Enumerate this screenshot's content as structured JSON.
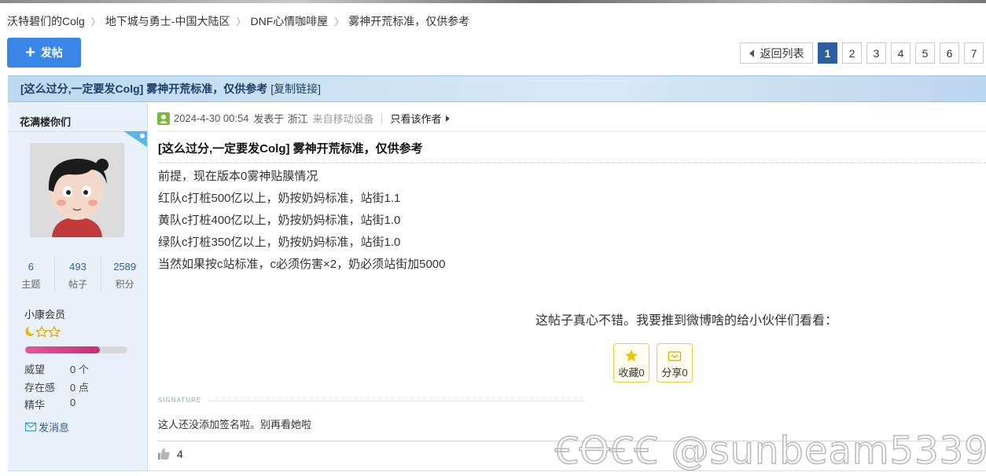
{
  "breadcrumb": {
    "items": [
      "沃特碧们的Colg",
      "地下城与勇士-中国大陆区",
      "DNF心情咖啡屋",
      "雾神开荒标准，仅供参考"
    ]
  },
  "toolbar": {
    "post_label": "发帖",
    "post_icon": "plus-icon"
  },
  "pager": {
    "back_label": "返回列表",
    "pages": [
      "1",
      "2",
      "3",
      "4",
      "5",
      "6",
      "7"
    ],
    "current": "1"
  },
  "thread": {
    "title": "[这么过分,一定要发Colg] 雾神开荒标准，仅供参考",
    "copy_link": "[复制链接]"
  },
  "user": {
    "name": "花满楼你们",
    "stats": [
      {
        "value": "6",
        "label": "主题"
      },
      {
        "value": "493",
        "label": "帖子"
      },
      {
        "value": "2589",
        "label": "积分"
      }
    ],
    "rank": "小康会员",
    "rank_icons": "moon-star-star",
    "credit_progress": 0.73,
    "info": [
      {
        "key": "威望",
        "value": "0 个"
      },
      {
        "key": "存在感",
        "value": "0 点"
      },
      {
        "key": "精华",
        "value": "0"
      }
    ],
    "message_label": "发消息"
  },
  "post": {
    "date": "2024-4-30 00:54",
    "posted_in_label": "发表于",
    "location": "浙江",
    "device": "来自移动设备",
    "author_only_label": "只看该作者",
    "title": "[这么过分,一定要发Colg] 雾神开荒标准，仅供参考",
    "lines": [
      "前提，现在版本0雾神贴膜情况",
      "红队c打桩500亿以上，奶按奶妈标准，站街1.1",
      "黄队c打桩400亿以上，奶按奶妈标准，站街1.0",
      "绿队c打桩350亿以上，奶按奶妈标准，站街1.0",
      "当然如果按c站标准，c必须伤害×2，奶必须站街加5000"
    ],
    "share_prompt": "这帖子真心不错。我要推到微博啥的给小伙伴们看看：",
    "favorite_label": "收藏0",
    "share_label": "分享0",
    "signature_label": "SIGNATURE",
    "signature_text": "这人还没添加签名啦。别再看她啦",
    "likes": "4"
  },
  "watermark": "COLG @sunbeam5339",
  "colors": {
    "accent": "#3a86e8",
    "active_page": "#2c5ea0",
    "thread_bar": "#cfe4f4",
    "sidebar": "#e8f1fa"
  }
}
